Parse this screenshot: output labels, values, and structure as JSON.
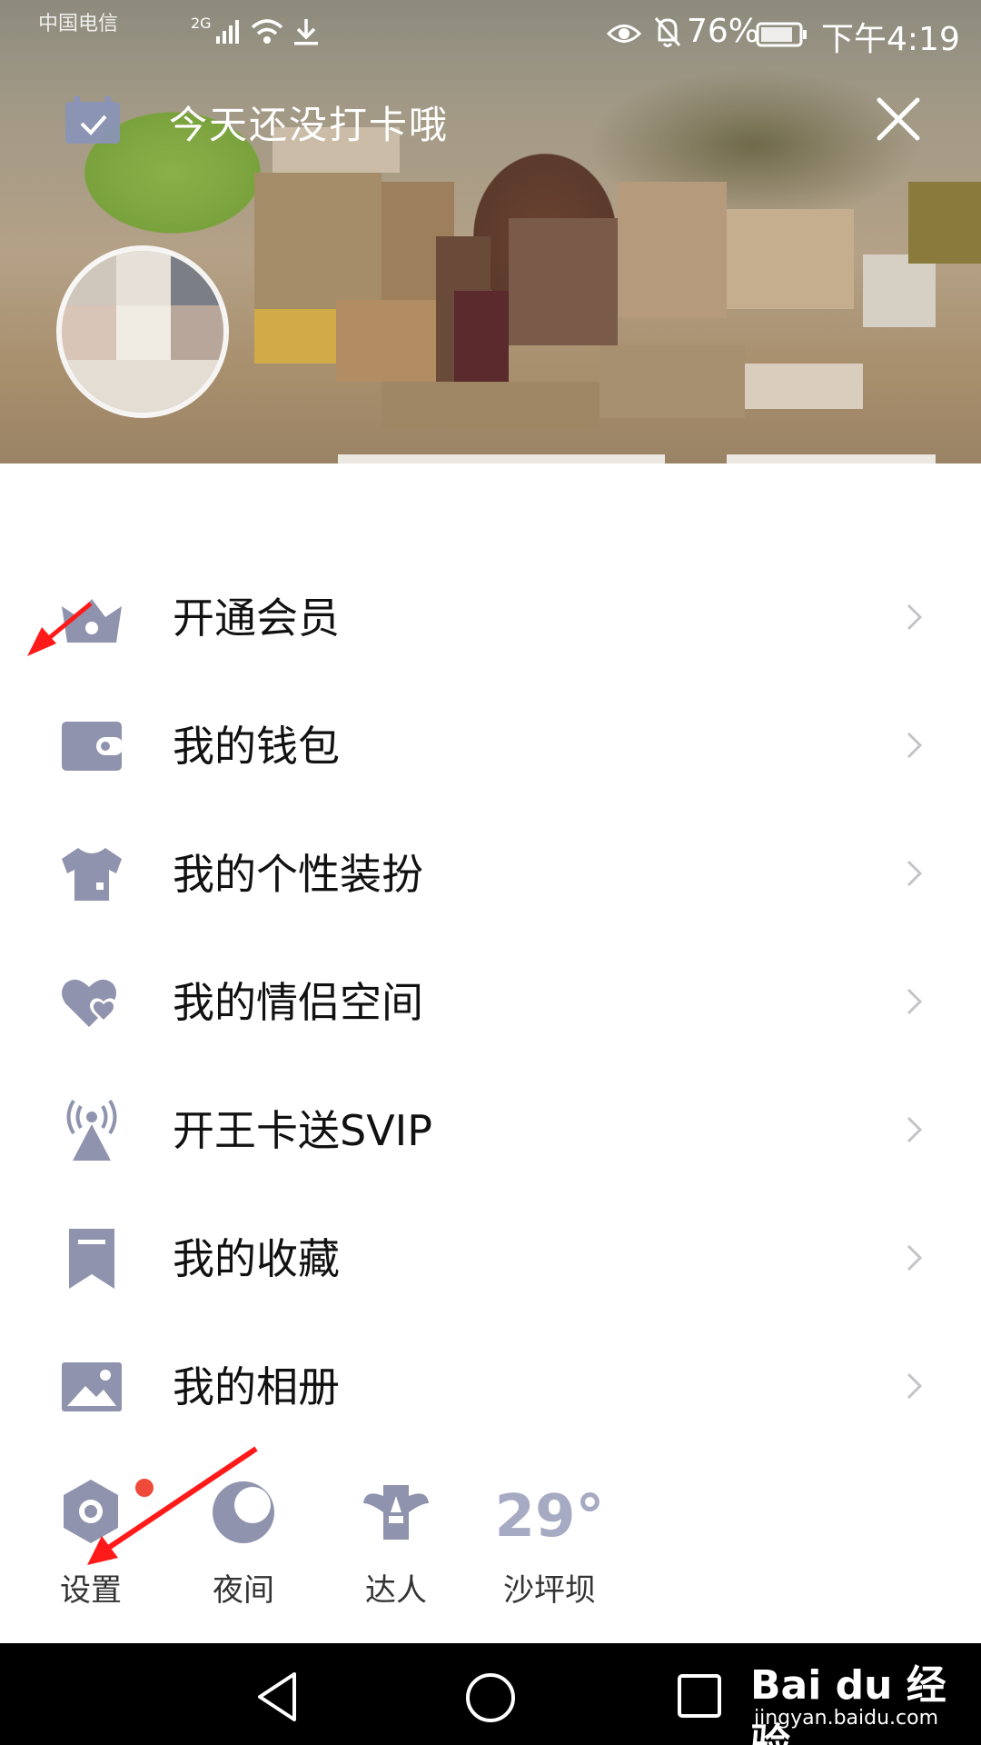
{
  "status_bar": {
    "carrier": "中国电信",
    "network": "2G",
    "battery_pct": "76%",
    "time": "下午4:19"
  },
  "header": {
    "message": "今天还没打卡哦",
    "close_icon": "close-icon",
    "calendar_icon": "calendar-check-icon"
  },
  "menu": {
    "items": [
      {
        "label": "开通会员",
        "icon": "vip-crown-icon"
      },
      {
        "label": "我的钱包",
        "icon": "wallet-icon"
      },
      {
        "label": "我的个性装扮",
        "icon": "shirt-icon"
      },
      {
        "label": "我的情侣空间",
        "icon": "hearts-icon"
      },
      {
        "label": "开王卡送SVIP",
        "icon": "signal-tower-icon"
      },
      {
        "label": "我的收藏",
        "icon": "bookmark-icon"
      },
      {
        "label": "我的相册",
        "icon": "photo-album-icon"
      }
    ]
  },
  "quickbar": {
    "settings_label": "设置",
    "night_label": "夜间",
    "expert_label": "达人",
    "weather_temp": "29°",
    "weather_place": "沙坪坝"
  },
  "watermark": {
    "logo": "Bai du 经验",
    "url": "jingyan.baidu.com"
  },
  "colors": {
    "icon": "#8f93ad",
    "chevron": "#c4c4c8",
    "badge": "#f04a3a",
    "annotation": "#ff1a1a"
  }
}
